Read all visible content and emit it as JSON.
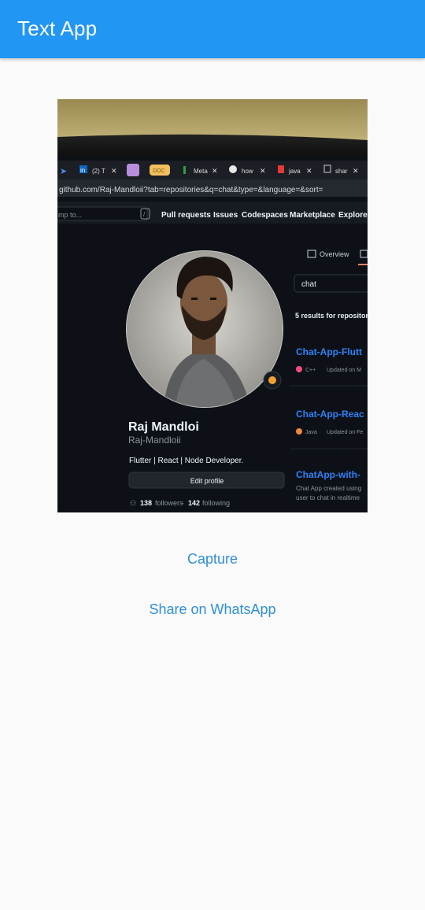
{
  "app_bar": {
    "title": "Text App",
    "color": "#2196f3"
  },
  "photo": {
    "browser_tabs": [
      "(2) T",
      "DOC",
      "Meta",
      "how",
      "java",
      "shar"
    ],
    "address_bar": "github.com/Raj-Mandloii?tab=repositories&q=chat&type=&language=&sort=",
    "search_text": "mp to...",
    "nav_links": [
      "Pull requests",
      "Issues",
      "Codespaces",
      "Marketplace",
      "Explore"
    ],
    "overview_tab": "Overview",
    "repo_search_value": "chat",
    "results_text": "5 results for repositori",
    "profile_name": "Raj Mandloi",
    "profile_username": "Raj-Mandloii",
    "bio": "Flutter | React | Node Developer.",
    "edit_profile": "Edit profile",
    "followers_count": "138",
    "followers_label": "followers",
    "following_count": "142",
    "following_label": "following",
    "repos": [
      {
        "name": "Chat-App-Flutt",
        "lang": "C++",
        "lang_color": "#f34b7d",
        "updated": "Updated on M"
      },
      {
        "name": "Chat-App-Reac",
        "lang": "Java",
        "lang_color": "#f0883e",
        "updated": "Updated on Fe"
      },
      {
        "name": "ChatApp-with-",
        "desc1": "Chat App created using",
        "desc2": "user to chat in realtime"
      }
    ]
  },
  "buttons": {
    "capture": "Capture",
    "share": "Share on WhatsApp"
  }
}
